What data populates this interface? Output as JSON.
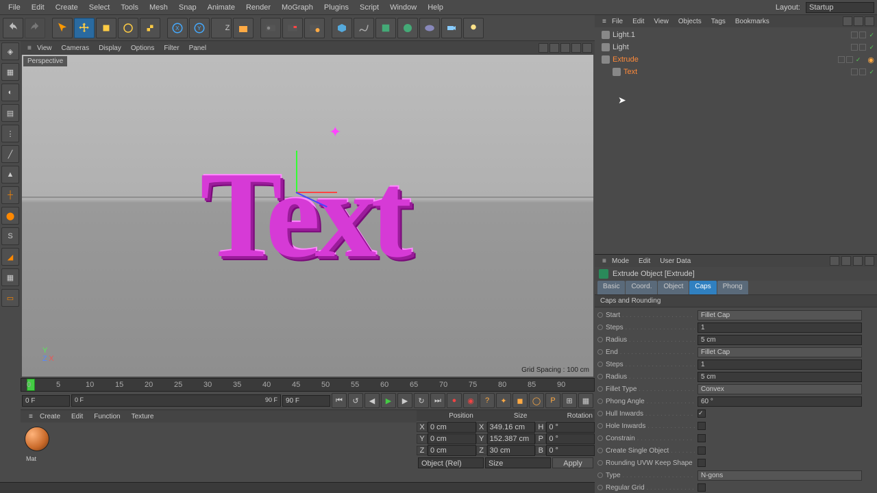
{
  "menu": {
    "items": [
      "File",
      "Edit",
      "Create",
      "Select",
      "Tools",
      "Mesh",
      "Snap",
      "Animate",
      "Render",
      "MoGraph",
      "Plugins",
      "Script",
      "Window",
      "Help"
    ],
    "layout_label": "Layout:",
    "layout_value": "Startup"
  },
  "viewport": {
    "menu": [
      "View",
      "Cameras",
      "Display",
      "Options",
      "Filter",
      "Panel"
    ],
    "label": "Perspective",
    "grid_spacing": "Grid Spacing : 100 cm",
    "text_content": "Text"
  },
  "timeline": {
    "ticks": [
      "0",
      "5",
      "10",
      "15",
      "20",
      "25",
      "30",
      "35",
      "40",
      "45",
      "50",
      "55",
      "60",
      "65",
      "70",
      "75",
      "80",
      "85",
      "90"
    ],
    "cur": "0 F",
    "start": "0 F",
    "end": "90 F",
    "end2": "90 F"
  },
  "materials": {
    "menu": [
      "Create",
      "Edit",
      "Function",
      "Texture"
    ],
    "mat_name": "Mat"
  },
  "coord": {
    "headers": [
      "Position",
      "Size",
      "Rotation"
    ],
    "rows": [
      {
        "axis": "X",
        "pos": "0 cm",
        "size": "349.16 cm",
        "rlbl": "H",
        "rot": "0 °"
      },
      {
        "axis": "Y",
        "pos": "0 cm",
        "size": "152.387 cm",
        "rlbl": "P",
        "rot": "0 °"
      },
      {
        "axis": "Z",
        "pos": "0 cm",
        "size": "30 cm",
        "rlbl": "B",
        "rot": "0 °"
      }
    ],
    "dd1": "Object (Rel)",
    "dd2": "Size",
    "apply": "Apply"
  },
  "objmgr": {
    "menu": [
      "File",
      "Edit",
      "View",
      "Objects",
      "Tags",
      "Bookmarks"
    ],
    "items": [
      {
        "name": "Light.1",
        "sel": false,
        "indent": 0
      },
      {
        "name": "Light",
        "sel": false,
        "indent": 0
      },
      {
        "name": "Extrude",
        "sel": true,
        "indent": 0,
        "tag": true
      },
      {
        "name": "Text",
        "sel": true,
        "indent": 1
      }
    ]
  },
  "attr": {
    "menu": [
      "Mode",
      "Edit",
      "User Data"
    ],
    "title": "Extrude Object [Extrude]",
    "tabs": [
      "Basic",
      "Coord.",
      "Object",
      "Caps",
      "Phong"
    ],
    "active_tab": "Caps",
    "section": "Caps and Rounding",
    "props": [
      {
        "label": "Start",
        "type": "dd",
        "value": "Fillet Cap"
      },
      {
        "label": "Steps",
        "type": "num",
        "value": "1"
      },
      {
        "label": "Radius",
        "type": "num",
        "value": "5 cm"
      },
      {
        "label": "End",
        "type": "dd",
        "value": "Fillet Cap"
      },
      {
        "label": "Steps",
        "type": "num",
        "value": "1"
      },
      {
        "label": "Radius",
        "type": "num",
        "value": "5 cm"
      },
      {
        "label": "Fillet Type",
        "type": "dd",
        "value": "Convex"
      },
      {
        "label": "Phong Angle",
        "type": "num",
        "value": "60 °"
      },
      {
        "label": "Hull Inwards",
        "type": "chk",
        "value": true
      },
      {
        "label": "Hole Inwards",
        "type": "chk",
        "value": false
      },
      {
        "label": "Constrain",
        "type": "chk",
        "value": false
      },
      {
        "label": "Create Single Object",
        "type": "chk",
        "value": false
      },
      {
        "label": "Rounding UVW Keep Shape",
        "type": "chk",
        "value": false
      },
      {
        "label": "Type",
        "type": "dd",
        "value": "N-gons"
      },
      {
        "label": "Regular Grid",
        "type": "chk",
        "value": false
      }
    ]
  }
}
